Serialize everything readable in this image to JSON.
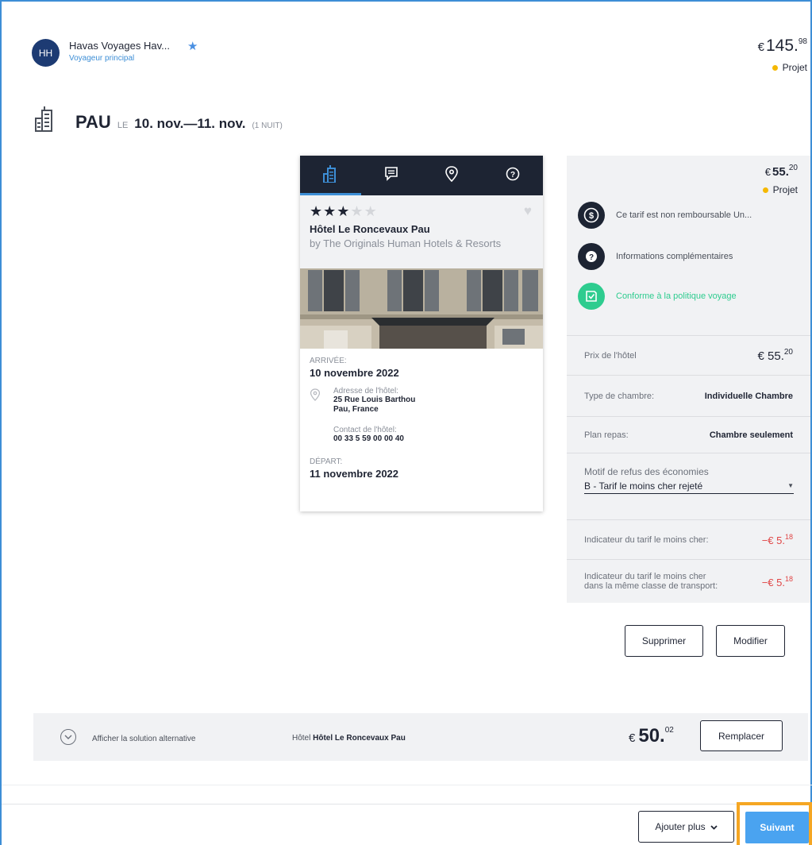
{
  "traveler": {
    "initials": "HH",
    "name": "Havas Voyages Hav...",
    "role": "Voyageur principal"
  },
  "total": {
    "currency": "€",
    "amount": "145.",
    "cents": "98",
    "status": "Projet"
  },
  "trip": {
    "city": "PAU",
    "le": "LE",
    "dates": "10. nov.—11. nov.",
    "nights": "(1 NUIT)"
  },
  "card": {
    "tabs": [
      "hotel-icon",
      "comment-icon",
      "location-icon",
      "help-icon"
    ],
    "rating": 3,
    "rating_max": 5,
    "hotel_name": "Hôtel Le Roncevaux Pau",
    "chain": "by The Originals Human Hotels & Resorts",
    "arrival_label": "ARRIVÉE:",
    "arrival_date": "10 novembre 2022",
    "address_label": "Adresse de l'hôtel:",
    "address_line1": "25 Rue Louis Barthou",
    "address_line2": "Pau, France",
    "contact_label": "Contact de l'hôtel:",
    "contact_phone": "00 33 5 59 00 00 40",
    "departure_label": "DÉPART:",
    "departure_date": "11 novembre 2022"
  },
  "panel": {
    "price_currency": "€",
    "price_amount": "55.",
    "price_cents": "20",
    "status": "Projet",
    "refund_text": "Ce tarif est non remboursable Un...",
    "info_text": "Informations complémentaires",
    "policy_text": "Conforme à la politique voyage",
    "hotel_price_label": "Prix de l'hôtel",
    "hotel_price_currency": "€",
    "hotel_price_amount": "55.",
    "hotel_price_cents": "20",
    "room_type_label": "Type de chambre:",
    "room_type_value": "Individuelle Chambre",
    "meal_plan_label": "Plan repas:",
    "meal_plan_value": "Chambre seulement",
    "motif_label": "Motif de refus des économies",
    "motif_value": "B - Tarif le moins cher rejeté",
    "cheapest_label": "Indicateur du tarif le moins cher:",
    "cheapest_value": "−€ 5.",
    "cheapest_cents": "18",
    "cheapest_class_label": "Indicateur du tarif le moins cher dans la même classe de transport:",
    "cheapest_class_value": "−€ 5.",
    "cheapest_class_cents": "18"
  },
  "actions": {
    "delete": "Supprimer",
    "modify": "Modifier"
  },
  "alternative": {
    "toggle_label": "Afficher la solution alternative",
    "hotel_prefix": "Hôtel",
    "hotel_name": "Hôtel Le Roncevaux Pau",
    "currency": "€",
    "amount": "50.",
    "cents": "02",
    "replace_label": "Remplacer"
  },
  "footer": {
    "add_more": "Ajouter plus",
    "next": "Suivant"
  },
  "colors": {
    "accent": "#3d8ed6",
    "navy": "#1d2433",
    "status_dot": "#f5b800",
    "compliant_green": "#2ecc8f",
    "negative_red": "#e04545",
    "highlight_orange": "#f5a623"
  }
}
